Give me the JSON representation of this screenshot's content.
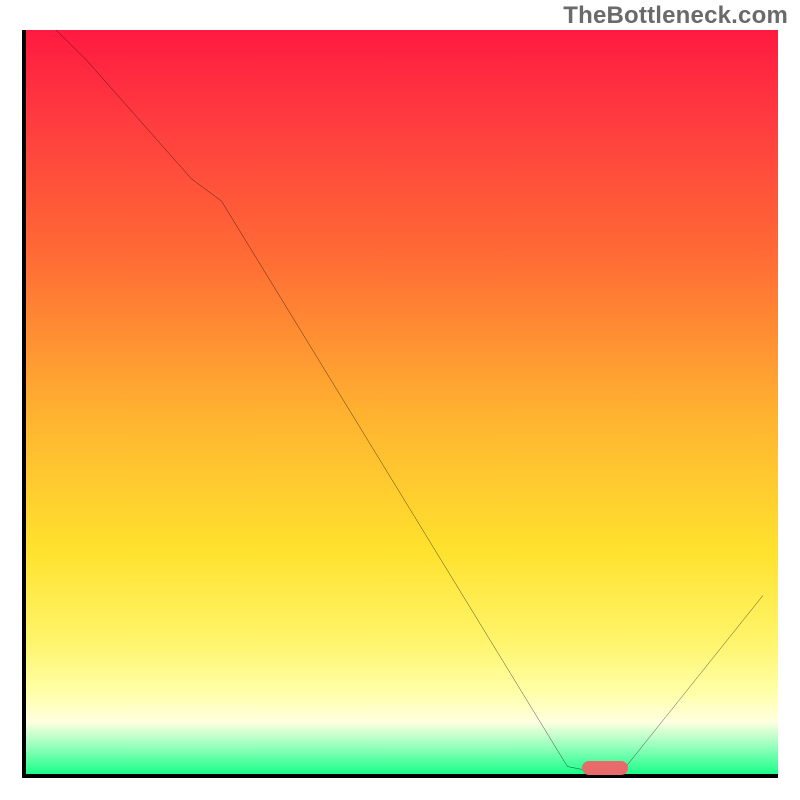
{
  "watermark": "TheBottleneck.com",
  "chart_data": {
    "type": "line",
    "title": "",
    "xlabel": "",
    "ylabel": "",
    "xlim": [
      0,
      100
    ],
    "ylim": [
      0,
      100
    ],
    "series": [
      {
        "name": "curve",
        "x": [
          0,
          8,
          22,
          26,
          72,
          77,
          79,
          98
        ],
        "values": [
          104,
          96,
          80,
          77,
          1,
          0,
          0,
          24
        ]
      }
    ],
    "marker": {
      "x_start": 74,
      "x_end": 80,
      "y": 0.8
    },
    "background_gradient": {
      "stops": [
        {
          "pct": 0,
          "color": "#ff1a40"
        },
        {
          "pct": 12,
          "color": "#ff3b40"
        },
        {
          "pct": 30,
          "color": "#ff6a35"
        },
        {
          "pct": 52,
          "color": "#ffb330"
        },
        {
          "pct": 70,
          "color": "#ffe22e"
        },
        {
          "pct": 82,
          "color": "#fff46a"
        },
        {
          "pct": 89,
          "color": "#ffffa8"
        },
        {
          "pct": 93,
          "color": "#ffffe0"
        },
        {
          "pct": 96,
          "color": "#9fffc0"
        },
        {
          "pct": 100,
          "color": "#1aff8a"
        }
      ]
    }
  }
}
